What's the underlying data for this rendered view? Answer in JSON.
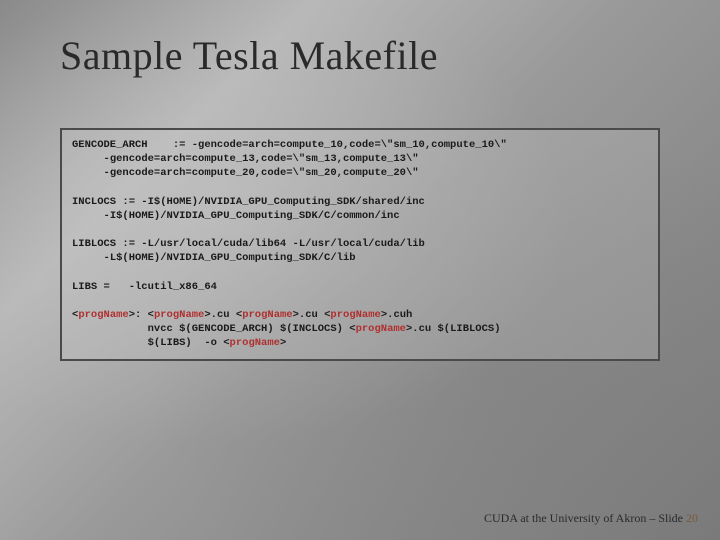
{
  "title": "Sample Tesla Makefile",
  "code": {
    "l1": "GENCODE_ARCH    := -gencode=arch=compute_10,code=\\\"sm_10,compute_10\\\"",
    "l2": "     -gencode=arch=compute_13,code=\\\"sm_13,compute_13\\\"",
    "l3": "     -gencode=arch=compute_20,code=\\\"sm_20,compute_20\\\"",
    "l4": "INCLOCS := -I$(HOME)/NVIDIA_GPU_Computing_SDK/shared/inc",
    "l5": "     -I$(HOME)/NVIDIA_GPU_Computing_SDK/C/common/inc",
    "l6": "LIBLOCS := -L/usr/local/cuda/lib64 -L/usr/local/cuda/lib",
    "l7": "     -L$(HOME)/NVIDIA_GPU_Computing_SDK/C/lib",
    "l8": "LIBS =   -lcutil_x86_64",
    "ph": "progName",
    "t1a": "<",
    "t1b": ">: <",
    "t1c": ">.cu <",
    "t1d": ">.cu <",
    "t1e": ">.cuh",
    "t2a": "            nvcc $(GENCODE_ARCH) $(INCLOCS) <",
    "t2b": ">.cu $(LIBLOCS)",
    "t3a": "            $(LIBS)  -o <",
    "t3b": ">"
  },
  "footer": {
    "text": "CUDA at the University of Akron – Slide ",
    "num": "20"
  }
}
